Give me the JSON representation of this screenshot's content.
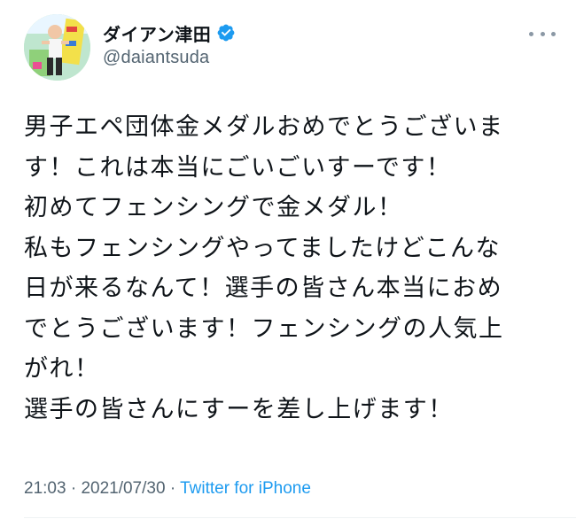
{
  "tweet": {
    "author": {
      "display_name": "ダイアン津田",
      "handle": "@daiantsuda",
      "verified": true,
      "verified_color": "#1d9bf0"
    },
    "body_lines": [
      "男子エペ団体金メダルおめでとうございま",
      "す！これは本当にごいごいすーです！",
      "初めてフェンシングで金メダル！",
      "私もフェンシングやってましたけどこんな",
      "日が来るなんて！選手の皆さん本当におめ",
      "でとうございます！フェンシングの人気上",
      "がれ！",
      "選手の皆さんにすーを差し上げます！"
    ],
    "time": "21:03",
    "separator": "·",
    "date": "2021/07/30",
    "source": "Twitter for iPhone",
    "more_icon": "more-horizontal-icon"
  },
  "colors": {
    "text": "#0f1419",
    "secondary": "#536471",
    "link": "#1d9bf0"
  }
}
